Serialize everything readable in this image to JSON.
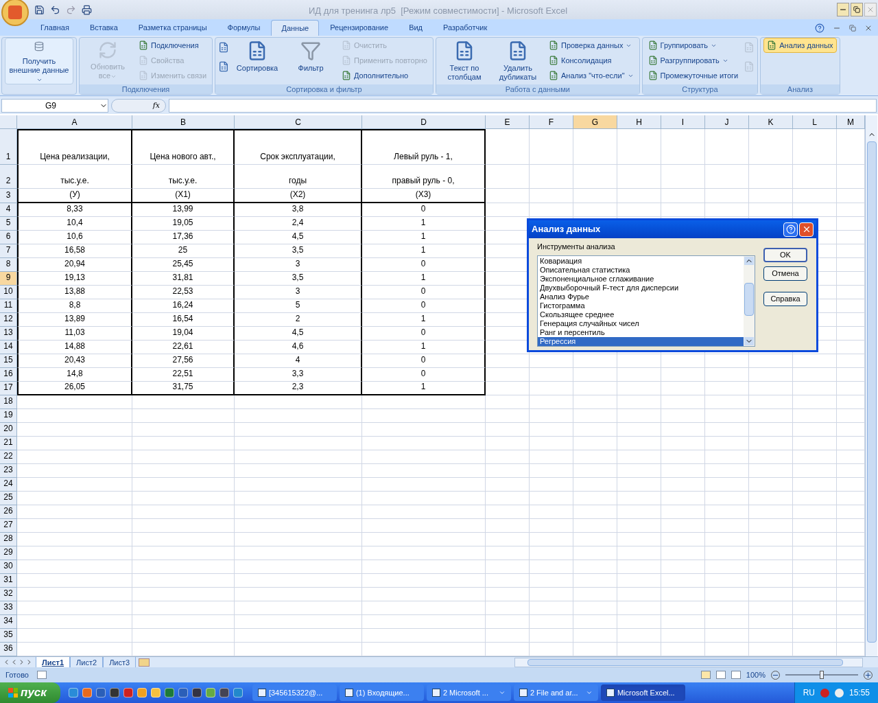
{
  "window": {
    "title": "ИД для тренинга лр5  [Режим совместимости] - Microsoft Excel"
  },
  "tabs": [
    {
      "label": "Главная",
      "selected": false
    },
    {
      "label": "Вставка",
      "selected": false
    },
    {
      "label": "Разметка страницы",
      "selected": false
    },
    {
      "label": "Формулы",
      "selected": false
    },
    {
      "label": "Данные",
      "selected": true
    },
    {
      "label": "Рецензирование",
      "selected": false
    },
    {
      "label": "Вид",
      "selected": false
    },
    {
      "label": "Разработчик",
      "selected": false
    }
  ],
  "ribbon_groups": [
    {
      "columns": [
        [
          {
            "kind": "large",
            "label": "Получить внешние данные",
            "disabled": false,
            "dropdown": true,
            "highlighted": false
          }
        ]
      ]
    },
    {
      "label": "Подключения",
      "columns": [
        [
          {
            "kind": "large",
            "label": "Обновить все",
            "disabled": true,
            "dropdown": true,
            "highlighted": false
          }
        ],
        [
          {
            "kind": "small",
            "label": "Подключения",
            "disabled": false,
            "dropdown": false,
            "highlighted": false
          },
          {
            "kind": "small",
            "label": "Свойства",
            "disabled": true,
            "dropdown": false,
            "highlighted": false
          },
          {
            "kind": "small",
            "label": "Изменить связи",
            "disabled": true,
            "dropdown": false,
            "highlighted": false
          }
        ]
      ]
    },
    {
      "label": "Сортировка и фильтр",
      "columns": [
        [
          {
            "kind": "icon",
            "disabled": false
          },
          {
            "kind": "icon",
            "disabled": false
          }
        ],
        [
          {
            "kind": "large",
            "label": "Сортировка",
            "disabled": false,
            "dropdown": false,
            "highlighted": false
          }
        ],
        [
          {
            "kind": "large",
            "label": "Фильтр",
            "disabled": false,
            "dropdown": false,
            "highlighted": false
          }
        ],
        [
          {
            "kind": "small",
            "label": "Очистить",
            "disabled": true,
            "dropdown": false,
            "highlighted": false
          },
          {
            "kind": "small",
            "label": "Применить повторно",
            "disabled": true,
            "dropdown": false,
            "highlighted": false
          },
          {
            "kind": "small",
            "label": "Дополнительно",
            "disabled": false,
            "dropdown": false,
            "highlighted": false
          }
        ]
      ]
    },
    {
      "label": "Работа с данными",
      "columns": [
        [
          {
            "kind": "large",
            "label": "Текст по столбцам",
            "disabled": false,
            "dropdown": false,
            "highlighted": false
          }
        ],
        [
          {
            "kind": "large",
            "label": "Удалить дубликаты",
            "disabled": false,
            "dropdown": false,
            "highlighted": false
          }
        ],
        [
          {
            "kind": "small",
            "label": "Проверка данных",
            "disabled": false,
            "dropdown": true,
            "highlighted": false
          },
          {
            "kind": "small",
            "label": "Консолидация",
            "disabled": false,
            "dropdown": false,
            "highlighted": false
          },
          {
            "kind": "small",
            "label": "Анализ \"что-если\"",
            "disabled": false,
            "dropdown": true,
            "highlighted": false
          }
        ]
      ]
    },
    {
      "label": "Структура",
      "columns": [
        [
          {
            "kind": "small",
            "label": "Группировать",
            "disabled": false,
            "dropdown": true,
            "highlighted": false
          },
          {
            "kind": "small",
            "label": "Разгруппировать",
            "disabled": false,
            "dropdown": true,
            "highlighted": false
          },
          {
            "kind": "small",
            "label": "Промежуточные итоги",
            "disabled": false,
            "dropdown": false,
            "highlighted": false
          }
        ],
        [
          {
            "kind": "icon",
            "disabled": true
          },
          {
            "kind": "icon",
            "disabled": true
          }
        ]
      ]
    },
    {
      "label": "Анализ",
      "columns": [
        [
          {
            "kind": "small",
            "label": "Анализ данных",
            "disabled": false,
            "dropdown": false,
            "highlighted": true
          }
        ]
      ]
    }
  ],
  "formula_bar": {
    "name_box": "G9",
    "fx_label": "fx"
  },
  "sheet": {
    "columns": [
      {
        "label": "A",
        "selected": false
      },
      {
        "label": "B",
        "selected": false
      },
      {
        "label": "C",
        "selected": false
      },
      {
        "label": "D",
        "selected": false
      },
      {
        "label": "E",
        "selected": false
      },
      {
        "label": "F",
        "selected": false
      },
      {
        "label": "G",
        "selected": true
      },
      {
        "label": "H",
        "selected": false
      },
      {
        "label": "I",
        "selected": false
      },
      {
        "label": "J",
        "selected": false
      },
      {
        "label": "K",
        "selected": false
      },
      {
        "label": "L",
        "selected": false
      },
      {
        "label": "M",
        "selected": false
      }
    ],
    "rows": [
      {
        "label": "1",
        "selected": false,
        "cells": [
          "Цена реализации,",
          "Цена нового авт.,",
          "Срок эксплуатации,",
          "Левый руль - 1,"
        ]
      },
      {
        "label": "2",
        "selected": false,
        "cells": [
          "тыс.у.е.",
          "тыс.у.е.",
          "годы",
          "правый руль - 0,"
        ]
      },
      {
        "label": "3",
        "selected": false,
        "cells": [
          "(У)",
          "(Х1)",
          "(Х2)",
          "(Х3)"
        ]
      },
      {
        "label": "4",
        "selected": false,
        "cells": [
          "8,33",
          "13,99",
          "3,8",
          "0"
        ]
      },
      {
        "label": "5",
        "selected": false,
        "cells": [
          "10,4",
          "19,05",
          "2,4",
          "1"
        ]
      },
      {
        "label": "6",
        "selected": false,
        "cells": [
          "10,6",
          "17,36",
          "4,5",
          "1"
        ]
      },
      {
        "label": "7",
        "selected": false,
        "cells": [
          "16,58",
          "25",
          "3,5",
          "1"
        ]
      },
      {
        "label": "8",
        "selected": false,
        "cells": [
          "20,94",
          "25,45",
          "3",
          "0"
        ]
      },
      {
        "label": "9",
        "selected": true,
        "cells": [
          "19,13",
          "31,81",
          "3,5",
          "1"
        ]
      },
      {
        "label": "10",
        "selected": false,
        "cells": [
          "13,88",
          "22,53",
          "3",
          "0"
        ]
      },
      {
        "label": "11",
        "selected": false,
        "cells": [
          "8,8",
          "16,24",
          "5",
          "0"
        ]
      },
      {
        "label": "12",
        "selected": false,
        "cells": [
          "13,89",
          "16,54",
          "2",
          "1"
        ]
      },
      {
        "label": "13",
        "selected": false,
        "cells": [
          "11,03",
          "19,04",
          "4,5",
          "0"
        ]
      },
      {
        "label": "14",
        "selected": false,
        "cells": [
          "14,88",
          "22,61",
          "4,6",
          "1"
        ]
      },
      {
        "label": "15",
        "selected": false,
        "cells": [
          "20,43",
          "27,56",
          "4",
          "0"
        ]
      },
      {
        "label": "16",
        "selected": false,
        "cells": [
          "14,8",
          "22,51",
          "3,3",
          "0"
        ]
      },
      {
        "label": "17",
        "selected": false,
        "cells": [
          "26,05",
          "31,75",
          "2,3",
          "1"
        ]
      },
      {
        "label": "18",
        "selected": false
      },
      {
        "label": "19",
        "selected": false
      },
      {
        "label": "20",
        "selected": false
      },
      {
        "label": "21",
        "selected": false
      },
      {
        "label": "22",
        "selected": false
      },
      {
        "label": "23",
        "selected": false
      },
      {
        "label": "24",
        "selected": false
      },
      {
        "label": "25",
        "selected": false
      },
      {
        "label": "26",
        "selected": false
      },
      {
        "label": "27",
        "selected": false
      },
      {
        "label": "28",
        "selected": false
      },
      {
        "label": "29",
        "selected": false
      },
      {
        "label": "30",
        "selected": false
      },
      {
        "label": "31",
        "selected": false
      },
      {
        "label": "32",
        "selected": false
      },
      {
        "label": "33",
        "selected": false
      },
      {
        "label": "34",
        "selected": false
      },
      {
        "label": "35",
        "selected": false
      },
      {
        "label": "36",
        "selected": false
      }
    ]
  },
  "dialog": {
    "title": "Анализ данных",
    "list_label": "Инструменты анализа",
    "items": [
      {
        "label": "Ковариация",
        "selected": false
      },
      {
        "label": "Описательная статистика",
        "selected": false
      },
      {
        "label": "Экспоненциальное сглаживание",
        "selected": false
      },
      {
        "label": "Двухвыборочный F-тест для дисперсии",
        "selected": false
      },
      {
        "label": "Анализ Фурье",
        "selected": false
      },
      {
        "label": "Гистограмма",
        "selected": false
      },
      {
        "label": "Скользящее среднее",
        "selected": false
      },
      {
        "label": "Генерация случайных чисел",
        "selected": false
      },
      {
        "label": "Ранг и персентиль",
        "selected": false
      },
      {
        "label": "Регрессия",
        "selected": true
      }
    ],
    "buttons": [
      "OK",
      "Отмена",
      "Справка"
    ]
  },
  "sheet_tabs": [
    {
      "label": "Лист1",
      "selected": true
    },
    {
      "label": "Лист2",
      "selected": false
    },
    {
      "label": "Лист3",
      "selected": false
    }
  ],
  "status_bar": {
    "status": "Готово",
    "zoom": "100%",
    "zoom_slider": {
      "level": 0.5
    }
  },
  "taskbar": {
    "start": "пуск",
    "tasks": [
      {
        "label": "[345615322@...",
        "selected": false,
        "dropdown": false
      },
      {
        "label": "(1) Входящие...",
        "selected": false,
        "dropdown": false
      },
      {
        "label": "2 Microsoft ...",
        "selected": false,
        "dropdown": true
      },
      {
        "label": "2 File and ar...",
        "selected": false,
        "dropdown": true
      },
      {
        "label": "Microsoft Excel...",
        "selected": true,
        "dropdown": false
      }
    ],
    "language": "RU",
    "clock": "15:55"
  }
}
